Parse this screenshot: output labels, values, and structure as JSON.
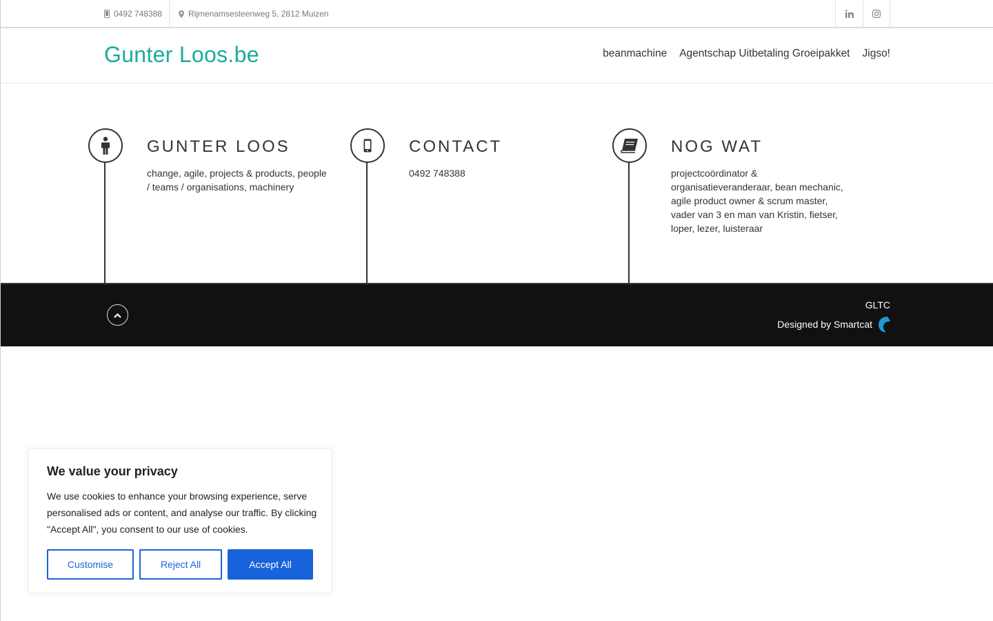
{
  "topbar": {
    "phone": "0492 748388",
    "address": "Rijmenamsesteenweg 5, 2812 Muizen",
    "social": [
      {
        "icon": "linkedin-icon"
      },
      {
        "icon": "instagram-icon"
      }
    ]
  },
  "header": {
    "logo": "Gunter Loos.be",
    "nav": [
      "beanmachine",
      "Agentschap Uitbetaling Groeipakket",
      "Jigso!"
    ]
  },
  "features": [
    {
      "icon": "person-icon",
      "title": "GUNTER LOOS",
      "text": "change, agile, projects & products, people / teams / organisations, machinery"
    },
    {
      "icon": "mobile-phone-icon",
      "title": "CONTACT",
      "text": "0492 748388"
    },
    {
      "icon": "book-icon",
      "title": "NOG WAT",
      "text": "projectcoördinator & organisatieveranderaar, bean mechanic, agile product owner & scrum master, vader van 3 en man van Kristin, fietser, loper, lezer, luisteraar"
    }
  ],
  "footer": {
    "brand": "GLTC",
    "credit": "Designed by Smartcat"
  },
  "cookie": {
    "title": "We value your privacy",
    "text": "We use cookies to enhance your browsing experience, serve personalised ads or content, and analyse our traffic. By clicking \"Accept All\", you consent to our use of cookies.",
    "buttons": {
      "customise": "Customise",
      "reject": "Reject All",
      "accept": "Accept All"
    }
  },
  "colors": {
    "brand": "#1aab9c",
    "accent_blue": "#1863dc",
    "footer_bg": "#111111"
  }
}
